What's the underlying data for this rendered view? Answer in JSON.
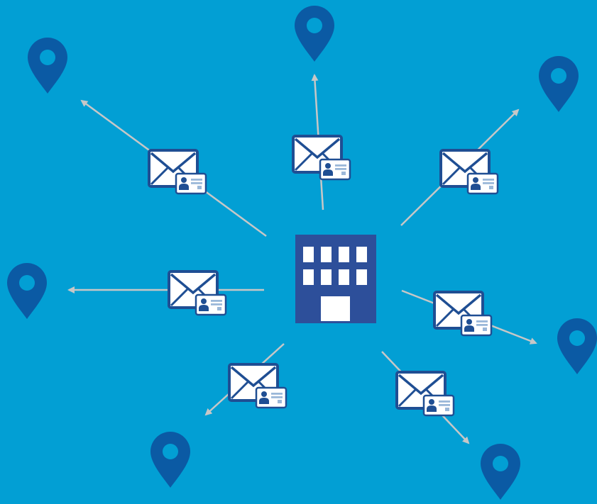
{
  "diagram": {
    "background_color": "#029fd4",
    "pin_color": "#0b5aa4",
    "arrow_color": "#c7c7c7",
    "building_color": "#2d4f9a",
    "envelope_fill": "#ffffff",
    "envelope_stroke": "#1f4e93",
    "card_fill": "#ffffff",
    "card_stroke": "#1f4e93",
    "card_line_color": "#9bb8d9",
    "center": {
      "icon": "office-building-icon"
    },
    "destinations": [
      {
        "name": "top-left",
        "pin_icon": "location-pin-icon",
        "message_icon": "envelope-with-contact-card-icon"
      },
      {
        "name": "top",
        "pin_icon": "location-pin-icon",
        "message_icon": "envelope-with-contact-card-icon"
      },
      {
        "name": "top-right",
        "pin_icon": "location-pin-icon",
        "message_icon": "envelope-with-contact-card-icon"
      },
      {
        "name": "left",
        "pin_icon": "location-pin-icon",
        "message_icon": "envelope-with-contact-card-icon"
      },
      {
        "name": "right",
        "pin_icon": "location-pin-icon",
        "message_icon": "envelope-with-contact-card-icon"
      },
      {
        "name": "bottom-left",
        "pin_icon": "location-pin-icon",
        "message_icon": "envelope-with-contact-card-icon"
      },
      {
        "name": "bottom-right",
        "pin_icon": "location-pin-icon",
        "message_icon": "envelope-with-contact-card-icon"
      }
    ]
  }
}
